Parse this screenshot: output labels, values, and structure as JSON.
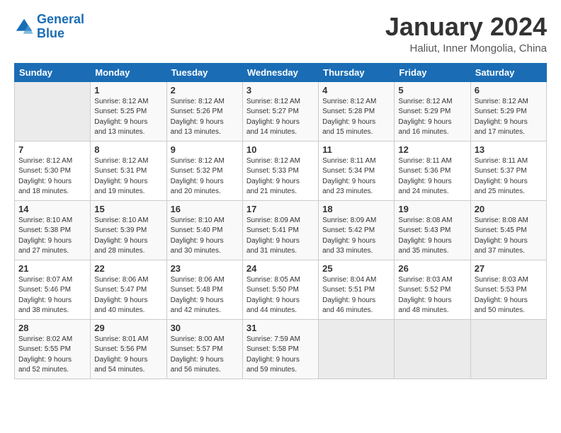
{
  "header": {
    "logo_line1": "General",
    "logo_line2": "Blue",
    "title": "January 2024",
    "subtitle": "Haliut, Inner Mongolia, China"
  },
  "columns": [
    "Sunday",
    "Monday",
    "Tuesday",
    "Wednesday",
    "Thursday",
    "Friday",
    "Saturday"
  ],
  "weeks": [
    [
      {
        "day": "",
        "info": ""
      },
      {
        "day": "1",
        "info": "Sunrise: 8:12 AM\nSunset: 5:25 PM\nDaylight: 9 hours\nand 13 minutes."
      },
      {
        "day": "2",
        "info": "Sunrise: 8:12 AM\nSunset: 5:26 PM\nDaylight: 9 hours\nand 13 minutes."
      },
      {
        "day": "3",
        "info": "Sunrise: 8:12 AM\nSunset: 5:27 PM\nDaylight: 9 hours\nand 14 minutes."
      },
      {
        "day": "4",
        "info": "Sunrise: 8:12 AM\nSunset: 5:28 PM\nDaylight: 9 hours\nand 15 minutes."
      },
      {
        "day": "5",
        "info": "Sunrise: 8:12 AM\nSunset: 5:29 PM\nDaylight: 9 hours\nand 16 minutes."
      },
      {
        "day": "6",
        "info": "Sunrise: 8:12 AM\nSunset: 5:29 PM\nDaylight: 9 hours\nand 17 minutes."
      }
    ],
    [
      {
        "day": "7",
        "info": "Sunrise: 8:12 AM\nSunset: 5:30 PM\nDaylight: 9 hours\nand 18 minutes."
      },
      {
        "day": "8",
        "info": "Sunrise: 8:12 AM\nSunset: 5:31 PM\nDaylight: 9 hours\nand 19 minutes."
      },
      {
        "day": "9",
        "info": "Sunrise: 8:12 AM\nSunset: 5:32 PM\nDaylight: 9 hours\nand 20 minutes."
      },
      {
        "day": "10",
        "info": "Sunrise: 8:12 AM\nSunset: 5:33 PM\nDaylight: 9 hours\nand 21 minutes."
      },
      {
        "day": "11",
        "info": "Sunrise: 8:11 AM\nSunset: 5:34 PM\nDaylight: 9 hours\nand 23 minutes."
      },
      {
        "day": "12",
        "info": "Sunrise: 8:11 AM\nSunset: 5:36 PM\nDaylight: 9 hours\nand 24 minutes."
      },
      {
        "day": "13",
        "info": "Sunrise: 8:11 AM\nSunset: 5:37 PM\nDaylight: 9 hours\nand 25 minutes."
      }
    ],
    [
      {
        "day": "14",
        "info": "Sunrise: 8:10 AM\nSunset: 5:38 PM\nDaylight: 9 hours\nand 27 minutes."
      },
      {
        "day": "15",
        "info": "Sunrise: 8:10 AM\nSunset: 5:39 PM\nDaylight: 9 hours\nand 28 minutes."
      },
      {
        "day": "16",
        "info": "Sunrise: 8:10 AM\nSunset: 5:40 PM\nDaylight: 9 hours\nand 30 minutes."
      },
      {
        "day": "17",
        "info": "Sunrise: 8:09 AM\nSunset: 5:41 PM\nDaylight: 9 hours\nand 31 minutes."
      },
      {
        "day": "18",
        "info": "Sunrise: 8:09 AM\nSunset: 5:42 PM\nDaylight: 9 hours\nand 33 minutes."
      },
      {
        "day": "19",
        "info": "Sunrise: 8:08 AM\nSunset: 5:43 PM\nDaylight: 9 hours\nand 35 minutes."
      },
      {
        "day": "20",
        "info": "Sunrise: 8:08 AM\nSunset: 5:45 PM\nDaylight: 9 hours\nand 37 minutes."
      }
    ],
    [
      {
        "day": "21",
        "info": "Sunrise: 8:07 AM\nSunset: 5:46 PM\nDaylight: 9 hours\nand 38 minutes."
      },
      {
        "day": "22",
        "info": "Sunrise: 8:06 AM\nSunset: 5:47 PM\nDaylight: 9 hours\nand 40 minutes."
      },
      {
        "day": "23",
        "info": "Sunrise: 8:06 AM\nSunset: 5:48 PM\nDaylight: 9 hours\nand 42 minutes."
      },
      {
        "day": "24",
        "info": "Sunrise: 8:05 AM\nSunset: 5:50 PM\nDaylight: 9 hours\nand 44 minutes."
      },
      {
        "day": "25",
        "info": "Sunrise: 8:04 AM\nSunset: 5:51 PM\nDaylight: 9 hours\nand 46 minutes."
      },
      {
        "day": "26",
        "info": "Sunrise: 8:03 AM\nSunset: 5:52 PM\nDaylight: 9 hours\nand 48 minutes."
      },
      {
        "day": "27",
        "info": "Sunrise: 8:03 AM\nSunset: 5:53 PM\nDaylight: 9 hours\nand 50 minutes."
      }
    ],
    [
      {
        "day": "28",
        "info": "Sunrise: 8:02 AM\nSunset: 5:55 PM\nDaylight: 9 hours\nand 52 minutes."
      },
      {
        "day": "29",
        "info": "Sunrise: 8:01 AM\nSunset: 5:56 PM\nDaylight: 9 hours\nand 54 minutes."
      },
      {
        "day": "30",
        "info": "Sunrise: 8:00 AM\nSunset: 5:57 PM\nDaylight: 9 hours\nand 56 minutes."
      },
      {
        "day": "31",
        "info": "Sunrise: 7:59 AM\nSunset: 5:58 PM\nDaylight: 9 hours\nand 59 minutes."
      },
      {
        "day": "",
        "info": ""
      },
      {
        "day": "",
        "info": ""
      },
      {
        "day": "",
        "info": ""
      }
    ]
  ]
}
